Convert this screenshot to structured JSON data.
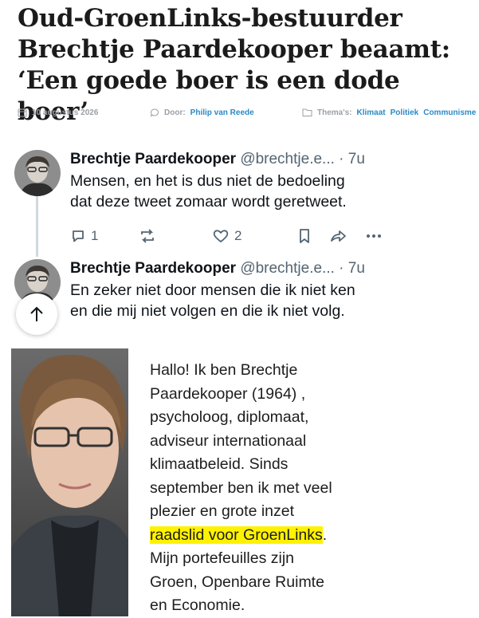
{
  "article": {
    "title_line1": "Oud-GroenLinks-bestuurder",
    "title_line2": "Brechtje Paardekooper beaamt:",
    "title_line3": "‘Een goede boer is een dode boer’"
  },
  "meta": {
    "date": "10 augustus 2026",
    "author_label": "Door:",
    "author": "Philip van Reede",
    "theme_label": "Thema's:",
    "themes": [
      "Klimaat",
      "Politiek",
      "Communisme"
    ]
  },
  "tweets": [
    {
      "name": "Brechtje Paardekooper",
      "handle": "@brechtje.e...",
      "dot": "·",
      "time": "7u",
      "text_line1": "Mensen, en het is dus niet de bedoeling",
      "text_line2": "dat deze tweet zomaar wordt geretweet.",
      "replies": "1",
      "likes": "2"
    },
    {
      "name": "Brechtje Paardekooper",
      "handle": "@brechtje.e...",
      "dot": "·",
      "time": "7u",
      "text_line1": "En zeker niet door mensen die ik niet ken",
      "text_line2": "en die mij niet volgen en die ik niet volg."
    }
  ],
  "bio": {
    "line1": "Hallo! Ik ben Brechtje",
    "line2": "Paardekooper (1964) ,",
    "line3": "psycholoog, diplomaat,",
    "line4": "adviseur internationaal",
    "line5": "klimaatbeleid. Sinds",
    "line6": "september ben ik met veel",
    "line7": "plezier en grote inzet",
    "line8_highlight": "raadslid voor GroenLinks",
    "line8_end": ".",
    "line9": "Mijn portefeuilles zijn",
    "line10": "Groen, Openbare Ruimte",
    "line11": "en Economie."
  },
  "colors": {
    "link": "#2b8ac6",
    "highlight": "#fff200",
    "muted": "#536471"
  }
}
